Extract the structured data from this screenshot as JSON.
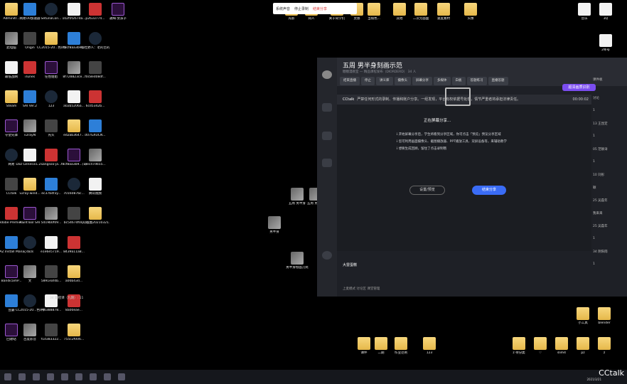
{
  "toolbar": {
    "item1": "系统声音",
    "item2": "停止录制",
    "item3": "结束分享"
  },
  "desktop_left": [
    "Adminitr...",
    "网易UU加速器",
    "SetunaCon...",
    "102f0f267da...",
    "p2633774...",
    "通缉·女孩子",
    "此电脑",
    "Origin",
    "CC2015-20...色环脚本（...",
    "f8cf8aa3b9...",
    "蔡杜野人：老的苦的黑...",
    "最低战网",
    "iTunes",
    "任性姐姐",
    "8f728823ce...",
    "f0c8ed08df...",
    "Steam",
    "SAI Ver.2",
    "123",
    "a02b5206a...",
    "6cd5342b...",
    "守望先锋",
    "v2rayN",
    "光头",
    "ed2ab3647...",
    "007GXUCN...",
    "网易",
    "Daz Genesis1.2...",
    "sangsoo-ja...",
    "f8cf8aa3b9...(1)",
    "eec47d655...",
    "CCtalk",
    "v2ray-wind...",
    "ec37b4f3y...",
    "7016087bc...",
    "腾讯视频",
    "Adobe Premie...",
    "PaintTool SAI",
    "5d19b0f09...",
    "bc5467df0...",
    "QQ截图20210321...",
    "DAZ Install Manager ...",
    "dazs",
    "e1e6e5719...",
    "8439a11a8...",
    "BandicamP...",
    "文",
    "5891eaf4b...",
    "a00b43d...",
    "豆霸",
    "CC2015-20...色环脚本（...",
    "7f6388878...",
    "8a00eae...",
    "回收站",
    "百度影音",
    "f1d383322...",
    "755c2f006..."
  ],
  "desktop_top": [
    "光影",
    "同人",
    "关于同学们",
    "灵感",
    "当角色...",
    "其他",
    "二次元画面",
    "速度素材",
    "头像"
  ],
  "desktop_right": [
    "音乐",
    "3Q",
    "2率号"
  ],
  "mid_icons": [
    "五周 男半身",
    "五周 男半身",
    "男半身",
    "男半身绘画刀式"
  ],
  "bottom_icons": [
    "课件",
    "二期",
    "作业范例",
    "123",
    "z 待分类",
    "♡",
    "slim4",
    "pz",
    "z",
    "小工具",
    "blender"
  ],
  "desk_label": "34 期授课（九期）: 11",
  "window": {
    "title": "五周 男半身刻画示范",
    "subtitle": "糖糖漫教室 — 精品课程发布（DIORDERD） 34 人",
    "tabs": [
      "结束直播",
      "停止",
      "讲义库",
      "摄像头",
      "屏幕分享",
      "多媒体",
      "白板",
      "答题练习",
      "直播答题"
    ],
    "live_badge": "超清画质识别",
    "notice_app": "CCtalk",
    "notice": "严禁任何形式的录制、传播和账户分享。一经发现，平台有权依据号处理，情节严重者将承担法律责任。",
    "timer": "00:00:02",
    "sharing": "正在屏幕分享...",
    "tips": [
      "开始屏幕分享后，学生将看到分享区域，你可点击「预览」预览分享区域",
      "您可利用画面摄像头、截图播放器、PPT播放工具、双屏设备等，来辅助教学",
      "想要生成回顾，留住了点击录制哦"
    ],
    "watermark": "stanlanobrg...",
    "btn_preview": "设置/预览",
    "btn_end": "结束分享",
    "user": "大雷蛋糕",
    "bottom_tools": "上麦模式  讨论区  课堂管理",
    "chat": [
      "讨论",
      "1",
      "13 王昆定",
      "1",
      "05 范静涛",
      "1",
      "10 刘彤",
      "颖",
      "25 吴磊年",
      "我来来",
      "25 吴磊年",
      "1",
      "34 阴阳雨",
      "1"
    ],
    "chat_top": "课件板"
  },
  "clock": "2021/3/21",
  "cctalk": "CCtalk",
  "videoframe": "stanlantpy"
}
